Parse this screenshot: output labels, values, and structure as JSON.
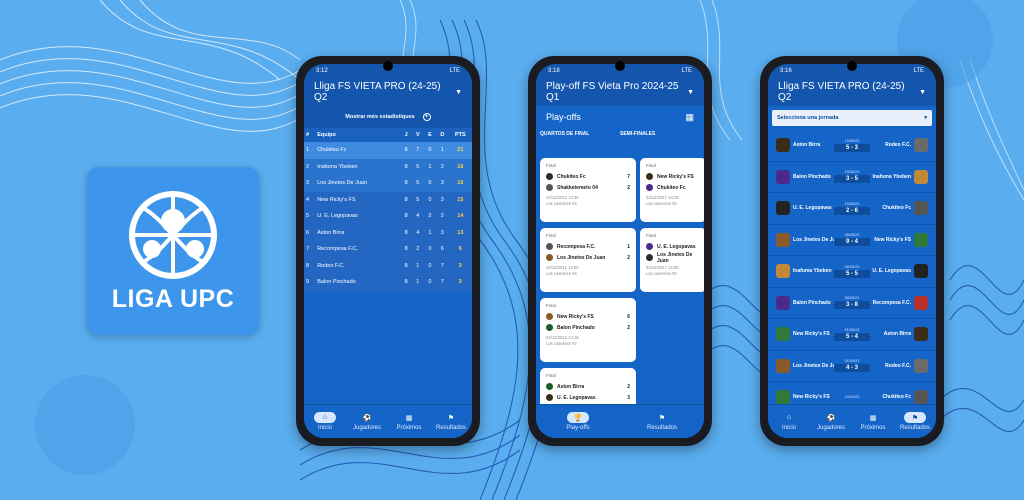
{
  "colors": {
    "background": "#5aaef0",
    "primary": "#1565c8",
    "appbar": "#1456ad",
    "points": "#ffd23c"
  },
  "app_icon": {
    "icon": "soccer-globe-icon",
    "label": "LIGA UPC"
  },
  "phone1": {
    "status": {
      "time": "3:12",
      "net": "LTE"
    },
    "title": "Lliga FS VIETA PRO (24-25) Q2",
    "stats_button": "Mostrar més estadístiques",
    "columns": [
      "#",
      "Equipo",
      "J",
      "V",
      "E",
      "D",
      "PTS"
    ],
    "rows": [
      [
        "1",
        "Chukiteo Fc",
        "8",
        "7",
        "0",
        "1",
        "21"
      ],
      [
        "2",
        "Inafuma Ybeben",
        "8",
        "5",
        "1",
        "2",
        "16"
      ],
      [
        "3",
        "Los Jinetes De Juan",
        "8",
        "5",
        "0",
        "3",
        "15"
      ],
      [
        "4",
        "New Ricky's FS",
        "8",
        "5",
        "0",
        "3",
        "15"
      ],
      [
        "5",
        "U. E. Legopavas",
        "8",
        "4",
        "2",
        "2",
        "14"
      ],
      [
        "6",
        "Aston Birra",
        "8",
        "4",
        "1",
        "3",
        "13"
      ],
      [
        "7",
        "Recompesa F.C.",
        "8",
        "2",
        "0",
        "6",
        "6"
      ],
      [
        "8",
        "Rodeo F.C.",
        "8",
        "1",
        "0",
        "7",
        "3"
      ],
      [
        "9",
        "Balon Pinchado",
        "8",
        "1",
        "0",
        "7",
        "3"
      ]
    ],
    "nav": [
      "Inicio",
      "Jugadores",
      "Próximos",
      "Resultados"
    ]
  },
  "phone2": {
    "status": {
      "time": "3:18",
      "net": "LTE"
    },
    "title": "Play-off FS Vieta Pro 2024-25 Q1",
    "section": "Play-offs",
    "col_quarters": "QUARTOS DE FINAL",
    "col_semis": "SEMI-FINALES",
    "matches": [
      {
        "label": "Final",
        "home": "Chukiteo Fc",
        "home_score": "7",
        "away": "Shakketemeto 04",
        "away_score": "2",
        "date": "24/12/2012 13:30",
        "venue": "Los caserries #2"
      },
      {
        "label": "Final",
        "home": "Recompesa F.C.",
        "home_score": "1",
        "away": "Los Jinetes De Juan",
        "away_score": "2",
        "date": "24/12/2012 13:50",
        "venue": "Los caserries #2"
      },
      {
        "label": "Final",
        "home": "New Ricky's FS",
        "home_score": "6",
        "away": "Balon Pinchado",
        "away_score": "2",
        "date": "24/12/2012 14:15",
        "venue": "Los caserries #2"
      },
      {
        "label": "Final",
        "home": "Aston Birra",
        "home_score": "2",
        "away": "U. E. Legopavas",
        "away_score": "3",
        "date": "",
        "venue": ""
      },
      {
        "label": "Final",
        "home": "New Ricky's FS",
        "home_score": "",
        "away": "Chukiteo Fc",
        "away_score": "",
        "date": "24/12/2017 14:15",
        "venue": "Los caserries #2"
      },
      {
        "label": "Final",
        "home": "U. E. Legopavas",
        "home_score": "",
        "away": "Los Jinetes De Juan",
        "away_score": "",
        "date": "24/12/2017 15:00",
        "venue": "Los caserries #2"
      }
    ],
    "nav": [
      "Play-offs",
      "Resultados"
    ]
  },
  "phone3": {
    "status": {
      "time": "3:16",
      "net": "LTE"
    },
    "title": "Lliga FS VIETA PRO (24-25) Q2",
    "jornada_label": "Selecciona una jornada",
    "results": [
      {
        "home": "Aston Birra",
        "away": "Rodeo F.C.",
        "date": "15/05/23",
        "score": "5 - 3",
        "home_color": "#3a2c18",
        "away_color": "#6b6b6b"
      },
      {
        "home": "Balon Pinchado",
        "away": "Inafuma Ybeben",
        "date": "15/05/23",
        "score": "3 - 5",
        "home_color": "#4a2a8a",
        "away_color": "#c08a3a"
      },
      {
        "home": "U. E. Legopavas",
        "away": "Chukiteo Fc",
        "date": "15/05/23",
        "score": "2 - 6",
        "home_color": "#222",
        "away_color": "#555"
      },
      {
        "home": "Los Jinetes De Juan",
        "away": "New Ricky's FS",
        "date": "08/05/23",
        "score": "9 - 4",
        "home_color": "#8a5a2a",
        "away_color": "#2f7a3a"
      },
      {
        "home": "Inafuma Ybeben",
        "away": "U. E. Legopavas",
        "date": "08/05/23",
        "score": "5 - 5",
        "home_color": "#c08a3a",
        "away_color": "#222"
      },
      {
        "home": "Balon Pinchado",
        "away": "Recompesa F.C.",
        "date": "08/05/23",
        "score": "3 - 8",
        "home_color": "#4a2a8a",
        "away_color": "#b5302a"
      },
      {
        "home": "New Ricky's FS",
        "away": "Aston Birra",
        "date": "01/05/23",
        "score": "5 - 4",
        "home_color": "#2f7a3a",
        "away_color": "#3a2c18"
      },
      {
        "home": "Los Jinetes De Juan",
        "away": "Rodeo F.C.",
        "date": "01/05/23",
        "score": "4 - 3",
        "home_color": "#8a5a2a",
        "away_color": "#6b6b6b"
      },
      {
        "home": "New Ricky's FS",
        "away": "Chukiteo Fc",
        "date": "24/04/23",
        "score": "",
        "home_color": "#2f7a3a",
        "away_color": "#555"
      }
    ],
    "nav": [
      "Inicio",
      "Jugadores",
      "Próximos",
      "Resultados"
    ]
  }
}
